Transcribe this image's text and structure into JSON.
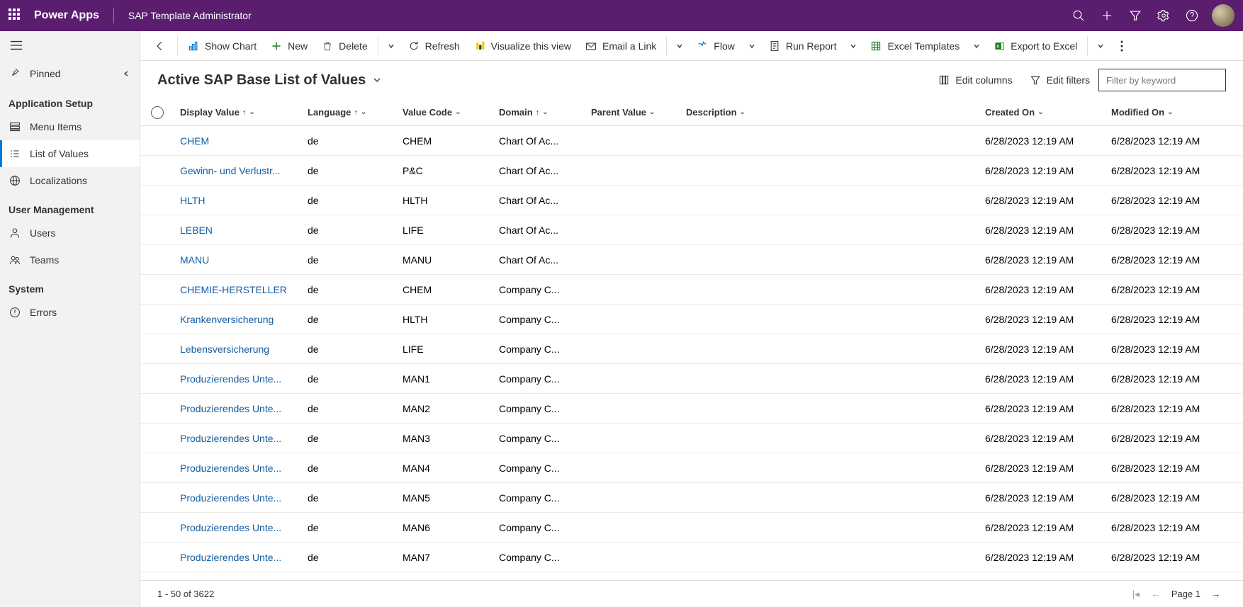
{
  "topbar": {
    "brand": "Power Apps",
    "appname": "SAP Template Administrator"
  },
  "sidebar": {
    "pinned": "Pinned",
    "sections": {
      "app_setup": "Application Setup",
      "user_mgmt": "User Management",
      "system": "System"
    },
    "items": {
      "menu_items": "Menu Items",
      "list_of_values": "List of Values",
      "localizations": "Localizations",
      "users": "Users",
      "teams": "Teams",
      "errors": "Errors"
    }
  },
  "cmdbar": {
    "show_chart": "Show Chart",
    "new": "New",
    "delete": "Delete",
    "refresh": "Refresh",
    "visualize": "Visualize this view",
    "email_link": "Email a Link",
    "flow": "Flow",
    "run_report": "Run Report",
    "excel_templates": "Excel Templates",
    "export_excel": "Export to Excel"
  },
  "view": {
    "title": "Active SAP Base List of Values",
    "edit_columns": "Edit columns",
    "edit_filters": "Edit filters",
    "filter_placeholder": "Filter by keyword"
  },
  "columns": {
    "display_value": "Display Value",
    "language": "Language",
    "value_code": "Value Code",
    "domain": "Domain",
    "parent_value": "Parent Value",
    "description": "Description",
    "created_on": "Created On",
    "modified_on": "Modified On"
  },
  "rows": [
    {
      "dv": "CHEM",
      "lang": "de",
      "vc": "CHEM",
      "dom": "Chart Of Ac...",
      "pv": "",
      "desc": "",
      "co": "6/28/2023 12:19 AM",
      "mo": "6/28/2023 12:19 AM"
    },
    {
      "dv": "Gewinn- und Verlustr...",
      "lang": "de",
      "vc": "P&C",
      "dom": "Chart Of Ac...",
      "pv": "",
      "desc": "",
      "co": "6/28/2023 12:19 AM",
      "mo": "6/28/2023 12:19 AM"
    },
    {
      "dv": "HLTH",
      "lang": "de",
      "vc": "HLTH",
      "dom": "Chart Of Ac...",
      "pv": "",
      "desc": "",
      "co": "6/28/2023 12:19 AM",
      "mo": "6/28/2023 12:19 AM"
    },
    {
      "dv": "LEBEN",
      "lang": "de",
      "vc": "LIFE",
      "dom": "Chart Of Ac...",
      "pv": "",
      "desc": "",
      "co": "6/28/2023 12:19 AM",
      "mo": "6/28/2023 12:19 AM"
    },
    {
      "dv": "MANU",
      "lang": "de",
      "vc": "MANU",
      "dom": "Chart Of Ac...",
      "pv": "",
      "desc": "",
      "co": "6/28/2023 12:19 AM",
      "mo": "6/28/2023 12:19 AM"
    },
    {
      "dv": "CHEMIE-HERSTELLER",
      "lang": "de",
      "vc": "CHEM",
      "dom": "Company C...",
      "pv": "",
      "desc": "",
      "co": "6/28/2023 12:19 AM",
      "mo": "6/28/2023 12:19 AM"
    },
    {
      "dv": "Krankenversicherung",
      "lang": "de",
      "vc": "HLTH",
      "dom": "Company C...",
      "pv": "",
      "desc": "",
      "co": "6/28/2023 12:19 AM",
      "mo": "6/28/2023 12:19 AM"
    },
    {
      "dv": "Lebensversicherung",
      "lang": "de",
      "vc": "LIFE",
      "dom": "Company C...",
      "pv": "",
      "desc": "",
      "co": "6/28/2023 12:19 AM",
      "mo": "6/28/2023 12:19 AM"
    },
    {
      "dv": "Produzierendes Unte...",
      "lang": "de",
      "vc": "MAN1",
      "dom": "Company C...",
      "pv": "",
      "desc": "",
      "co": "6/28/2023 12:19 AM",
      "mo": "6/28/2023 12:19 AM"
    },
    {
      "dv": "Produzierendes Unte...",
      "lang": "de",
      "vc": "MAN2",
      "dom": "Company C...",
      "pv": "",
      "desc": "",
      "co": "6/28/2023 12:19 AM",
      "mo": "6/28/2023 12:19 AM"
    },
    {
      "dv": "Produzierendes Unte...",
      "lang": "de",
      "vc": "MAN3",
      "dom": "Company C...",
      "pv": "",
      "desc": "",
      "co": "6/28/2023 12:19 AM",
      "mo": "6/28/2023 12:19 AM"
    },
    {
      "dv": "Produzierendes Unte...",
      "lang": "de",
      "vc": "MAN4",
      "dom": "Company C...",
      "pv": "",
      "desc": "",
      "co": "6/28/2023 12:19 AM",
      "mo": "6/28/2023 12:19 AM"
    },
    {
      "dv": "Produzierendes Unte...",
      "lang": "de",
      "vc": "MAN5",
      "dom": "Company C...",
      "pv": "",
      "desc": "",
      "co": "6/28/2023 12:19 AM",
      "mo": "6/28/2023 12:19 AM"
    },
    {
      "dv": "Produzierendes Unte...",
      "lang": "de",
      "vc": "MAN6",
      "dom": "Company C...",
      "pv": "",
      "desc": "",
      "co": "6/28/2023 12:19 AM",
      "mo": "6/28/2023 12:19 AM"
    },
    {
      "dv": "Produzierendes Unte...",
      "lang": "de",
      "vc": "MAN7",
      "dom": "Company C...",
      "pv": "",
      "desc": "",
      "co": "6/28/2023 12:19 AM",
      "mo": "6/28/2023 12:19 AM"
    }
  ],
  "footer": {
    "range": "1 - 50 of 3622",
    "page_label": "Page 1"
  }
}
